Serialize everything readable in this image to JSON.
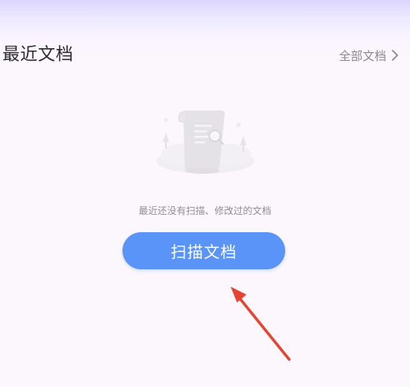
{
  "recent": {
    "title": "最近文档",
    "all_link_label": "全部文档"
  },
  "empty_state": {
    "message": "最近还没有扫描、修改过的文档",
    "icon": "document-search-illustration-icon"
  },
  "scan_button": {
    "label": "扫描文档",
    "color": "#5b94f8"
  },
  "annotation": {
    "icon": "red-arrow-icon",
    "color": "#e64430"
  }
}
